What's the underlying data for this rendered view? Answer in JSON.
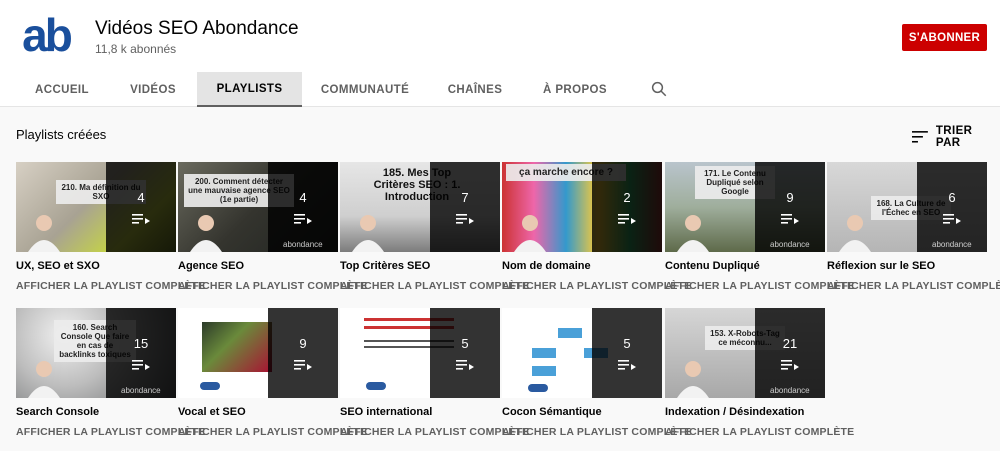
{
  "channel": {
    "name": "Vidéos SEO Abondance",
    "subscribers": "11,8 k abonnés",
    "avatar_text": "ab",
    "subscribe_label": "S'ABONNER"
  },
  "tabs": [
    {
      "label": "ACCUEIL",
      "active": false
    },
    {
      "label": "VIDÉOS",
      "active": false
    },
    {
      "label": "PLAYLISTS",
      "active": true
    },
    {
      "label": "COMMUNAUTÉ",
      "active": false
    },
    {
      "label": "CHAÎNES",
      "active": false
    },
    {
      "label": "À PROPOS",
      "active": false
    }
  ],
  "section": {
    "title": "Playlists créées",
    "sort_label": "TRIER PAR"
  },
  "playlists": [
    {
      "title": "UX, SEO et SXO",
      "count": "4",
      "thumb_text": "210. Ma définition du SXO",
      "link": "AFFICHER LA PLAYLIST COMPLÈTE"
    },
    {
      "title": "Agence SEO",
      "count": "4",
      "thumb_text": "200. Comment détecter une mauvaise agence SEO (1e partie)",
      "link": "AFFICHER LA PLAYLIST COMPLÈTE"
    },
    {
      "title": "Top Critères SEO",
      "count": "7",
      "thumb_text": "185. Mes Top Critères SEO : 1. Introduction",
      "link": "AFFICHER LA PLAYLIST COMPLÈTE"
    },
    {
      "title": "Nom de domaine",
      "count": "2",
      "thumb_text": "ça marche encore ?",
      "link": "AFFICHER LA PLAYLIST COMPLÈTE"
    },
    {
      "title": "Contenu Dupliqué",
      "count": "9",
      "thumb_text": "171. Le Contenu Dupliqué selon Google",
      "link": "AFFICHER LA PLAYLIST COMPLÈTE"
    },
    {
      "title": "Réflexion sur le SEO",
      "count": "6",
      "thumb_text": "168. La Culture de l'Échec en SEO",
      "link": "AFFICHER LA PLAYLIST COMPLÈTE"
    },
    {
      "title": "Search Console",
      "count": "15",
      "thumb_text": "160. Search Console Que faire en cas de backlinks toxiques",
      "link": "AFFICHER LA PLAYLIST COMPLÈTE"
    },
    {
      "title": "Vocal et SEO",
      "count": "9",
      "thumb_text": "",
      "link": "AFFICHER LA PLAYLIST COMPLÈTE"
    },
    {
      "title": "SEO international",
      "count": "5",
      "thumb_text": "",
      "link": "AFFICHER LA PLAYLIST COMPLÈTE"
    },
    {
      "title": "Cocon Sémantique",
      "count": "5",
      "thumb_text": "",
      "link": "AFFICHER LA PLAYLIST COMPLÈTE"
    },
    {
      "title": "Indexation / Désindexation",
      "count": "21",
      "thumb_text": "153. X-Robots-Tag ce méconnu...",
      "link": "AFFICHER LA PLAYLIST COMPLÈTE"
    }
  ],
  "brand_text": "abondance",
  "icons": [
    "search-icon",
    "sort-icon",
    "playlist-icon"
  ],
  "colors": {
    "accent": "#cc0000",
    "brand": "#1a4f9c"
  }
}
